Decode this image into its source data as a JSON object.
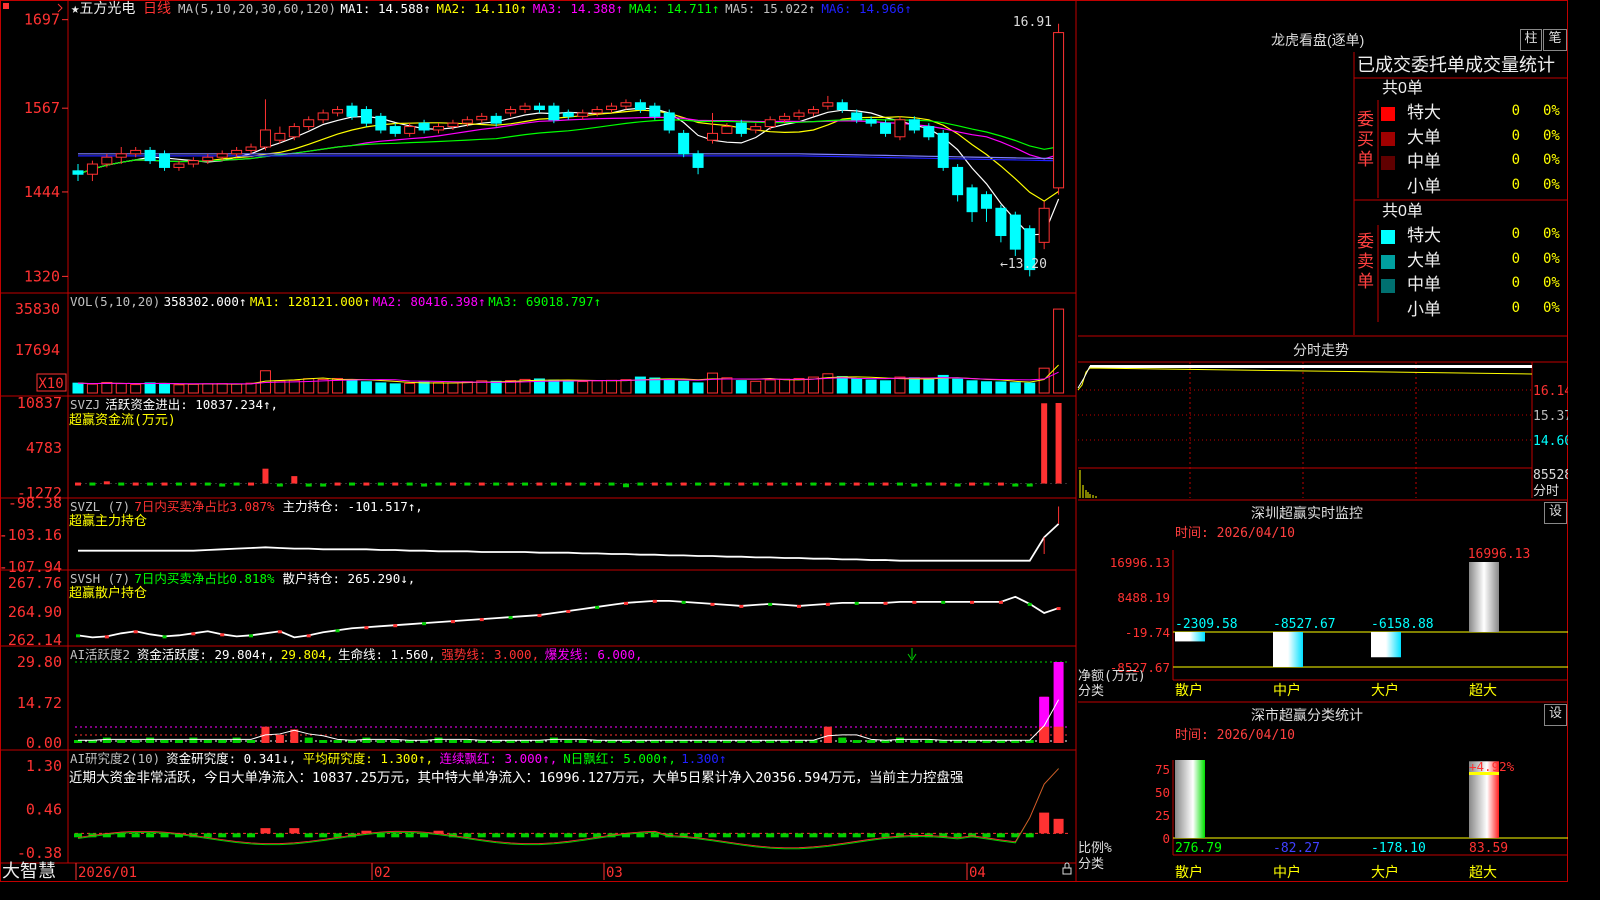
{
  "stock": {
    "name": "五方光电",
    "period": "日线",
    "star": "★"
  },
  "colors": {
    "up": "#ff3232",
    "down": "#00ffff",
    "bg": "#000000",
    "border": "#c00000",
    "ma1": "#ffffff",
    "ma2": "#ffff00",
    "ma3": "#ff00ff",
    "ma4": "#00ff00",
    "ma5": "#7f7fff",
    "ma6": "#2020ff",
    "axis": "#ff3232"
  },
  "main_panel": {
    "legend": [
      {
        "text": "MA(5,10,20,30,60,120)",
        "color": "#c0c0c0"
      },
      {
        "text": "MA1: 14.588↑",
        "color": "#ffffff"
      },
      {
        "text": "MA2: 14.110↑",
        "color": "#ffff00"
      },
      {
        "text": "MA3: 14.388↑",
        "color": "#ff00ff"
      },
      {
        "text": "MA4: 14.711↑",
        "color": "#00ff00"
      },
      {
        "text": "MA5: 15.022↑",
        "color": "#c0c0c0"
      },
      {
        "text": "MA6: 14.966↑",
        "color": "#2020ff"
      }
    ],
    "y_labels": [
      "1697",
      "1567",
      "1444",
      "1320"
    ],
    "high_marker": "16.91",
    "low_marker": "←13.20"
  },
  "chart_data": [
    {
      "type": "candlestick",
      "name": "日线",
      "x": [
        "2026-01-05",
        "2026-01-06",
        "2026-01-07",
        "2026-01-08",
        "2026-01-09",
        "2026-01-12",
        "2026-01-13",
        "2026-01-14",
        "2026-01-15",
        "2026-01-16",
        "2026-01-19",
        "2026-01-20",
        "2026-01-21",
        "2026-01-22",
        "2026-01-23",
        "2026-01-26",
        "2026-01-27",
        "2026-01-28",
        "2026-01-29",
        "2026-01-30",
        "2026-02-02",
        "2026-02-03",
        "2026-02-04",
        "2026-02-05",
        "2026-02-06",
        "2026-02-09",
        "2026-02-10",
        "2026-02-11",
        "2026-02-12",
        "2026-02-13",
        "2026-02-16",
        "2026-02-17",
        "2026-02-18",
        "2026-02-19",
        "2026-02-20",
        "2026-02-23",
        "2026-02-24",
        "2026-02-25",
        "2026-02-26",
        "2026-02-27",
        "2026-03-02",
        "2026-03-03",
        "2026-03-04",
        "2026-03-05",
        "2026-03-06",
        "2026-03-09",
        "2026-03-10",
        "2026-03-11",
        "2026-03-12",
        "2026-03-13",
        "2026-03-16",
        "2026-03-17",
        "2026-03-18",
        "2026-03-19",
        "2026-03-20",
        "2026-03-23",
        "2026-03-24",
        "2026-03-25",
        "2026-03-26",
        "2026-03-27",
        "2026-03-30",
        "2026-03-31",
        "2026-04-01",
        "2026-04-02",
        "2026-04-03",
        "2026-04-07",
        "2026-04-08",
        "2026-04-09",
        "2026-04-10"
      ],
      "open": [
        14.75,
        14.7,
        14.85,
        14.95,
        15.0,
        15.05,
        15.0,
        14.8,
        14.85,
        14.9,
        14.95,
        15.0,
        15.05,
        15.1,
        15.2,
        15.25,
        15.4,
        15.5,
        15.6,
        15.7,
        15.65,
        15.55,
        15.4,
        15.3,
        15.45,
        15.35,
        15.4,
        15.45,
        15.5,
        15.55,
        15.6,
        15.65,
        15.7,
        15.7,
        15.6,
        15.55,
        15.6,
        15.65,
        15.7,
        15.75,
        15.7,
        15.6,
        15.3,
        15.0,
        15.2,
        15.3,
        15.45,
        15.35,
        15.4,
        15.5,
        15.55,
        15.6,
        15.7,
        15.75,
        15.6,
        15.5,
        15.45,
        15.25,
        15.5,
        15.4,
        15.3,
        14.8,
        14.5,
        14.4,
        14.2,
        14.1,
        13.9,
        13.7,
        14.5
      ],
      "close": [
        14.7,
        14.85,
        14.95,
        15.0,
        15.05,
        14.9,
        14.8,
        14.85,
        14.9,
        14.95,
        15.0,
        15.05,
        15.1,
        15.35,
        15.3,
        15.4,
        15.5,
        15.6,
        15.65,
        15.55,
        15.45,
        15.35,
        15.3,
        15.4,
        15.35,
        15.4,
        15.45,
        15.5,
        15.55,
        15.45,
        15.65,
        15.7,
        15.65,
        15.5,
        15.55,
        15.6,
        15.65,
        15.7,
        15.75,
        15.65,
        15.55,
        15.35,
        15.0,
        14.8,
        15.3,
        15.4,
        15.3,
        15.4,
        15.5,
        15.55,
        15.6,
        15.65,
        15.75,
        15.65,
        15.5,
        15.45,
        15.3,
        15.5,
        15.35,
        15.25,
        14.8,
        14.4,
        14.15,
        14.2,
        13.8,
        13.6,
        13.3,
        14.2,
        16.78
      ],
      "high": [
        14.85,
        14.9,
        15.0,
        15.1,
        15.1,
        15.1,
        15.05,
        14.9,
        14.95,
        15.0,
        15.05,
        15.1,
        15.15,
        15.8,
        15.4,
        15.45,
        15.55,
        15.65,
        15.7,
        15.75,
        15.7,
        15.6,
        15.45,
        15.45,
        15.5,
        15.45,
        15.5,
        15.55,
        15.6,
        15.6,
        15.7,
        15.75,
        15.75,
        15.75,
        15.65,
        15.65,
        15.7,
        15.75,
        15.8,
        15.8,
        15.75,
        15.65,
        15.35,
        15.05,
        15.6,
        15.45,
        15.5,
        15.45,
        15.55,
        15.6,
        15.65,
        15.7,
        15.85,
        15.8,
        15.65,
        15.55,
        15.5,
        15.55,
        15.55,
        15.45,
        15.35,
        14.85,
        14.55,
        14.45,
        14.25,
        14.15,
        13.95,
        14.3,
        16.91
      ],
      "low": [
        14.6,
        14.6,
        14.8,
        14.85,
        14.95,
        14.85,
        14.75,
        14.75,
        14.8,
        14.85,
        14.9,
        14.95,
        15.0,
        15.05,
        15.15,
        15.2,
        15.35,
        15.45,
        15.55,
        15.5,
        15.4,
        15.3,
        15.25,
        15.25,
        15.3,
        15.3,
        15.35,
        15.4,
        15.45,
        15.4,
        15.55,
        15.6,
        15.6,
        15.45,
        15.5,
        15.5,
        15.55,
        15.6,
        15.65,
        15.6,
        15.5,
        15.3,
        14.95,
        14.7,
        15.15,
        15.3,
        15.25,
        15.3,
        15.35,
        15.45,
        15.5,
        15.55,
        15.65,
        15.6,
        15.45,
        15.4,
        15.25,
        15.2,
        15.3,
        15.2,
        14.75,
        14.3,
        14.0,
        14.0,
        13.7,
        13.5,
        13.2,
        13.6,
        14.4
      ]
    },
    {
      "type": "bar",
      "name": "VOL(5,10,20)",
      "unit": "X10",
      "y_labels": [
        "35830",
        "17694"
      ],
      "values": [
        4200,
        3800,
        4500,
        4000,
        3600,
        4300,
        4100,
        3500,
        3700,
        3900,
        4000,
        3800,
        4200,
        9500,
        5200,
        5400,
        6100,
        5800,
        6200,
        5500,
        4800,
        4300,
        3900,
        4100,
        4600,
        4400,
        4300,
        4800,
        5200,
        5000,
        5300,
        5800,
        6000,
        5500,
        5100,
        4900,
        5200,
        5400,
        5700,
        6800,
        6400,
        5900,
        5000,
        4300,
        8500,
        6500,
        5300,
        5000,
        5600,
        5900,
        6200,
        6800,
        8200,
        7000,
        6100,
        5500,
        5200,
        6800,
        6500,
        5800,
        7500,
        5900,
        5200,
        4800,
        4700,
        4400,
        4200,
        10600,
        35830
      ],
      "legend": [
        {
          "text": "VOL(5,10,20)",
          "color": "#c0c0c0"
        },
        {
          "text": "358302.000↑",
          "color": "#ffffff"
        },
        {
          "text": "MA1: 128121.000↑",
          "color": "#ffff00"
        },
        {
          "text": "MA2: 80416.398↑",
          "color": "#ff00ff"
        },
        {
          "text": "MA3: 69018.797↑",
          "color": "#00ff00"
        }
      ]
    },
    {
      "type": "bar",
      "name": "SVZJ",
      "y_labels": [
        "10837",
        "4783",
        "-1272"
      ],
      "values": [
        0,
        0,
        300,
        0,
        0,
        0,
        0,
        0,
        0,
        0,
        -300,
        0,
        0,
        2000,
        -200,
        1000,
        -100,
        -200,
        0,
        0,
        0,
        0,
        0,
        0,
        -300,
        0,
        0,
        0,
        0,
        0,
        0,
        0,
        0,
        0,
        0,
        0,
        0,
        0,
        -500,
        0,
        0,
        0,
        0,
        0,
        0,
        0,
        0,
        0,
        0,
        0,
        0,
        0,
        0,
        0,
        0,
        0,
        0,
        0,
        -200,
        0,
        0,
        -300,
        0,
        0,
        0,
        -300,
        -300,
        10800,
        10837
      ],
      "legend": [
        {
          "text": "SVZJ",
          "color": "#c0c0c0"
        },
        {
          "text": "活跃资金进出: 10837.234↑,",
          "color": "#ffffff"
        }
      ],
      "sublabel": "超赢资金流(万元)"
    },
    {
      "type": "line",
      "name": "SVZL (7)",
      "y_labels": [
        "-98.38",
        "-103.16",
        "-107.94"
      ],
      "values": [
        -105.5,
        -105.5,
        -105.5,
        -105.5,
        -105.5,
        -105.5,
        -105.5,
        -105.5,
        -105.5,
        -105.4,
        -105.3,
        -105.2,
        -105.1,
        -105.0,
        -105.1,
        -105.2,
        -105.2,
        -105.3,
        -105.3,
        -105.3,
        -105.3,
        -105.4,
        -105.4,
        -105.5,
        -105.5,
        -105.6,
        -105.6,
        -105.6,
        -105.7,
        -105.7,
        -105.7,
        -105.7,
        -105.8,
        -105.8,
        -105.8,
        -105.9,
        -105.9,
        -106.0,
        -106.0,
        -106.1,
        -106.1,
        -106.2,
        -106.2,
        -106.3,
        -106.3,
        -106.4,
        -106.4,
        -106.5,
        -106.5,
        -106.6,
        -106.6,
        -106.7,
        -106.7,
        -106.8,
        -106.8,
        -106.9,
        -106.9,
        -107.0,
        -107.0,
        -107.0,
        -107.0,
        -107.0,
        -107.0,
        -107.0,
        -107.0,
        -107.0,
        -107.0,
        -103.5,
        -101.5
      ],
      "legend": [
        {
          "text": "SVZL (7)",
          "color": "#c0c0c0"
        },
        {
          "text": "7日内买卖净占比3.087%",
          "color": "#ff3232"
        },
        {
          "text": "主力持仓: -101.517↑,",
          "color": "#ffffff"
        }
      ],
      "sublabel": "超赢主力持仓"
    },
    {
      "type": "line",
      "name": "SVSH (7)",
      "y_labels": [
        "267.76",
        "264.90",
        "262.14"
      ],
      "values": [
        262.6,
        262.4,
        262.5,
        262.8,
        263.0,
        262.7,
        262.5,
        262.6,
        262.8,
        263.0,
        262.7,
        262.5,
        262.6,
        262.8,
        263.0,
        262.4,
        262.6,
        262.9,
        263.1,
        263.3,
        263.4,
        263.5,
        263.6,
        263.7,
        263.8,
        263.9,
        264.0,
        264.1,
        264.2,
        264.3,
        264.4,
        264.5,
        264.6,
        264.8,
        265.0,
        265.2,
        265.4,
        265.6,
        265.8,
        265.9,
        266.0,
        266.0,
        265.9,
        265.8,
        265.7,
        265.6,
        265.5,
        265.6,
        265.7,
        265.6,
        265.5,
        265.6,
        265.7,
        265.8,
        265.8,
        265.8,
        265.8,
        265.9,
        265.9,
        265.9,
        265.9,
        265.9,
        265.9,
        265.9,
        265.9,
        266.4,
        265.7,
        264.8,
        265.29
      ],
      "legend": [
        {
          "text": "SVSH (7)",
          "color": "#c0c0c0"
        },
        {
          "text": "7日内买卖净占比0.818%",
          "color": "#00ff00"
        },
        {
          "text": "散户持仓: 265.290↓,",
          "color": "#ffffff"
        }
      ],
      "sublabel": "超赢散户持仓"
    },
    {
      "type": "bar",
      "name": "AI活跃度2",
      "y_labels": [
        "29.80",
        "14.72",
        "0.00"
      ],
      "values": [
        1,
        1,
        2,
        1,
        1,
        2,
        1,
        1,
        2,
        1,
        1,
        2,
        1,
        6,
        3,
        5,
        2,
        1,
        1,
        1,
        2,
        1,
        1,
        1,
        1,
        2,
        1,
        1,
        1,
        1,
        1,
        1,
        1,
        2,
        1,
        1,
        1,
        1,
        1,
        1,
        1,
        1,
        1,
        1,
        1,
        1,
        1,
        1,
        1,
        1,
        1,
        1,
        6,
        2,
        1,
        1,
        1,
        2,
        1,
        1,
        1,
        1,
        1,
        1,
        1,
        1,
        1,
        17,
        29.8
      ],
      "legend": [
        {
          "text": "AI活跃度2",
          "color": "#c0c0c0"
        },
        {
          "text": "资金活跃度: 29.804↑,",
          "color": "#ffffff"
        },
        {
          "text": "29.804,",
          "color": "#ffff00"
        },
        {
          "text": "生命线: 1.560,",
          "color": "#ffffff"
        },
        {
          "text": "强势线: 3.000,",
          "color": "#ff3232"
        },
        {
          "text": "爆发线: 6.000,",
          "color": "#ff00ff"
        }
      ]
    },
    {
      "type": "bar",
      "name": "AI研究度2(10)",
      "y_labels": [
        "1.30",
        "0.46",
        "-0.38"
      ],
      "values": [
        0,
        0,
        0,
        0,
        0,
        0,
        0,
        0,
        0,
        0,
        0,
        0,
        0,
        0.1,
        0,
        0.1,
        0,
        0,
        0,
        0,
        0.05,
        0,
        0,
        0,
        0,
        0.05,
        0,
        0,
        0,
        0,
        0,
        0,
        0,
        0,
        0,
        0,
        0,
        0,
        0,
        0,
        0,
        0,
        0,
        0,
        0,
        0,
        0,
        0,
        0,
        0,
        0,
        0,
        0,
        0,
        0,
        0,
        0,
        0,
        0,
        0,
        0,
        0,
        0,
        0,
        0,
        0,
        0,
        0.4,
        0.28
      ],
      "legend": [
        {
          "text": "AI研究度2(10)",
          "color": "#c0c0c0"
        },
        {
          "text": "资金研究度: 0.341↓,",
          "color": "#ffffff"
        },
        {
          "text": "平均研究度: 1.300↑,",
          "color": "#ffff00"
        },
        {
          "text": "连续飘红: 3.000↑,",
          "color": "#ff00ff"
        },
        {
          "text": "N日飘红: 5.000↑,",
          "color": "#00ff00"
        },
        {
          "text": "1.300↑",
          "color": "#2020ff"
        }
      ],
      "note": "近期大资金非常活跃，今日大单净流入：10837.25万元，其中特大单净流入：16996.127万元，大单5日累计净入20356.594万元，当前主力控盘强"
    },
    {
      "type": "bar",
      "name": "深圳超赢实时监控",
      "categories": [
        "散户",
        "中户",
        "大户",
        "超大"
      ],
      "values": [
        -2309.58,
        -8527.67,
        -6158.88,
        16996.13
      ],
      "y_labels": [
        "16996.13",
        "8488.19",
        "-19.74",
        "-8527.67"
      ],
      "ylabel": "净额(万元)",
      "xlabel": "分类"
    },
    {
      "type": "bar",
      "name": "深市超赢分类统计",
      "categories": [
        "散户",
        "中户",
        "大户",
        "超大"
      ],
      "values": [
        276.79,
        -82.27,
        -178.1,
        83.59
      ],
      "y_labels": [
        "75",
        "50",
        "25",
        "0"
      ],
      "top_label": "+4.92%",
      "ylabel": "比例%",
      "xlabel": "分类"
    }
  ],
  "x_axis_labels": [
    "2026/01",
    "02",
    "03",
    "04"
  ],
  "brand": "大智慧",
  "dragon_tiger": {
    "title": "龙虎看盘(逐单)",
    "btn_bar": "柱",
    "btn_count": "笔",
    "subtitle": "已成交委托单成交量统计",
    "buy": {
      "side": "委买单",
      "total": "共0单",
      "rows": [
        {
          "label": "特大",
          "count": "0",
          "pct": "0%",
          "color": "#ff0000"
        },
        {
          "label": "大单",
          "count": "0",
          "pct": "0%",
          "color": "#a00000"
        },
        {
          "label": "中单",
          "count": "0",
          "pct": "0%",
          "color": "#600000"
        },
        {
          "label": "小单",
          "count": "0",
          "pct": "0%",
          "color": ""
        }
      ]
    },
    "sell": {
      "side": "委卖单",
      "total": "共0单",
      "rows": [
        {
          "label": "特大",
          "count": "0",
          "pct": "0%",
          "color": "#00ffff"
        },
        {
          "label": "大单",
          "count": "0",
          "pct": "0%",
          "color": "#00a0a0"
        },
        {
          "label": "中单",
          "count": "0",
          "pct": "0%",
          "color": "#007070"
        },
        {
          "label": "小单",
          "count": "0",
          "pct": "0%",
          "color": ""
        }
      ]
    }
  },
  "intraday": {
    "title": "分时走势",
    "price_labels": [
      "16.14",
      "15.37",
      "14.60"
    ],
    "vol_label": "85528",
    "footer": "分时"
  },
  "monitor": {
    "title": "深圳超赢实时监控",
    "date": "时间: 2026/04/10",
    "btn": "设"
  },
  "stats": {
    "title": "深市超赢分类统计",
    "date": "时间: 2026/04/10",
    "btn": "设"
  }
}
